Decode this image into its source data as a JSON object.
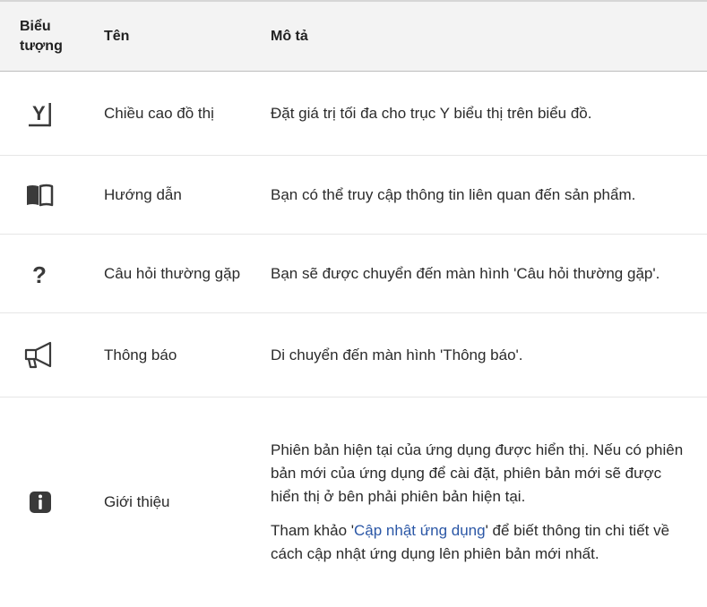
{
  "header": {
    "icon_col": "Biểu tượng",
    "name_col": "Tên",
    "desc_col": "Mô tả"
  },
  "rows": [
    {
      "icon": "y-axis-height-icon",
      "name": "Chiều cao đồ thị",
      "desc": "Đặt giá trị tối đa cho trục Y biểu thị trên biểu đồ."
    },
    {
      "icon": "book-guide-icon",
      "name": "Hướng dẫn",
      "desc": "Bạn có thể truy cập thông tin liên quan đến sản phẩm."
    },
    {
      "icon": "question-icon",
      "name": "Câu hỏi thường gặp",
      "desc": "Bạn sẽ được chuyển đến màn hình 'Câu hỏi thường gặp'."
    },
    {
      "icon": "megaphone-icon",
      "name": "Thông báo",
      "desc": "Di chuyển đến màn hình 'Thông báo'."
    },
    {
      "icon": "info-icon",
      "name": "Giới thiệu",
      "desc_1": "Phiên bản hiện tại của ứng dụng được hiển thị. Nếu có phiên bản mới của ứng dụng để cài đặt, phiên bản mới sẽ được hiển thị ở bên phải phiên bản hiện tại.",
      "desc_2_pre": "Tham khảo '",
      "desc_2_link": "Cập nhật ứng dụng",
      "desc_2_post": "' để biết thông tin chi tiết về cách cập nhật ứng dụng lên phiên bản mới nhất."
    }
  ],
  "colors": {
    "text": "#2b2b2b",
    "link": "#2b57a6",
    "header_bg": "#f3f3f3",
    "icon": "#3a3a3a"
  }
}
